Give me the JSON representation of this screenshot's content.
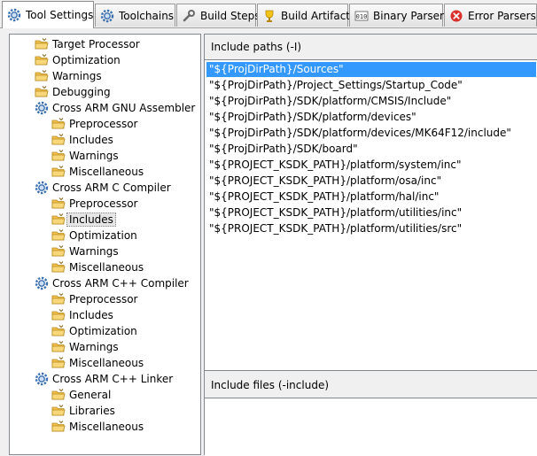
{
  "tabs": [
    {
      "label": "Tool Settings",
      "icon": "gear-icon",
      "active": true
    },
    {
      "label": "Toolchains",
      "icon": "gear-icon"
    },
    {
      "label": "Build Steps",
      "icon": "wrench-icon"
    },
    {
      "label": "Build Artifact",
      "icon": "trophy-icon"
    },
    {
      "label": "Binary Parsers",
      "icon": "binary-icon"
    },
    {
      "label": "Error Parsers",
      "icon": "error-icon"
    }
  ],
  "tree": [
    {
      "label": "Target Processor",
      "level": 0,
      "icon": "folder-icon"
    },
    {
      "label": "Optimization",
      "level": 0,
      "icon": "folder-icon"
    },
    {
      "label": "Warnings",
      "level": 0,
      "icon": "folder-icon"
    },
    {
      "label": "Debugging",
      "level": 0,
      "icon": "folder-icon"
    },
    {
      "label": "Cross ARM GNU Assembler",
      "level": 0,
      "icon": "gear-icon"
    },
    {
      "label": "Preprocessor",
      "level": 1,
      "icon": "folder-icon"
    },
    {
      "label": "Includes",
      "level": 1,
      "icon": "folder-icon"
    },
    {
      "label": "Warnings",
      "level": 1,
      "icon": "folder-icon"
    },
    {
      "label": "Miscellaneous",
      "level": 1,
      "icon": "folder-icon"
    },
    {
      "label": "Cross ARM C Compiler",
      "level": 0,
      "icon": "gear-icon"
    },
    {
      "label": "Preprocessor",
      "level": 1,
      "icon": "folder-icon"
    },
    {
      "label": "Includes",
      "level": 1,
      "icon": "folder-icon",
      "selected": true
    },
    {
      "label": "Optimization",
      "level": 1,
      "icon": "folder-icon"
    },
    {
      "label": "Warnings",
      "level": 1,
      "icon": "folder-icon"
    },
    {
      "label": "Miscellaneous",
      "level": 1,
      "icon": "folder-icon"
    },
    {
      "label": "Cross ARM C++ Compiler",
      "level": 0,
      "icon": "gear-icon"
    },
    {
      "label": "Preprocessor",
      "level": 1,
      "icon": "folder-icon"
    },
    {
      "label": "Includes",
      "level": 1,
      "icon": "folder-icon"
    },
    {
      "label": "Optimization",
      "level": 1,
      "icon": "folder-icon"
    },
    {
      "label": "Warnings",
      "level": 1,
      "icon": "folder-icon"
    },
    {
      "label": "Miscellaneous",
      "level": 1,
      "icon": "folder-icon"
    },
    {
      "label": "Cross ARM C++ Linker",
      "level": 0,
      "icon": "gear-icon"
    },
    {
      "label": "General",
      "level": 1,
      "icon": "folder-icon"
    },
    {
      "label": "Libraries",
      "level": 1,
      "icon": "folder-icon"
    },
    {
      "label": "Miscellaneous",
      "level": 1,
      "icon": "folder-icon"
    }
  ],
  "include_paths": {
    "title": "Include paths (-I)",
    "selected_index": 0,
    "items": [
      "\"${ProjDirPath}/Sources\"",
      "\"${ProjDirPath}/Project_Settings/Startup_Code\"",
      "\"${ProjDirPath}/SDK/platform/CMSIS/Include\"",
      "\"${ProjDirPath}/SDK/platform/devices\"",
      "\"${ProjDirPath}/SDK/platform/devices/MK64F12/include\"",
      "\"${ProjDirPath}/SDK/board\"",
      "\"${PROJECT_KSDK_PATH}/platform/system/inc\"",
      "\"${PROJECT_KSDK_PATH}/platform/osa/inc\"",
      "\"${PROJECT_KSDK_PATH}/platform/hal/inc\"",
      "\"${PROJECT_KSDK_PATH}/platform/utilities/inc\"",
      "\"${PROJECT_KSDK_PATH}/platform/utilities/src\""
    ]
  },
  "include_files": {
    "title": "Include files (-include)",
    "items": []
  },
  "colors": {
    "selection": "#3399ff",
    "folder": "#f2c14e",
    "gear": "#3a6fb0"
  }
}
